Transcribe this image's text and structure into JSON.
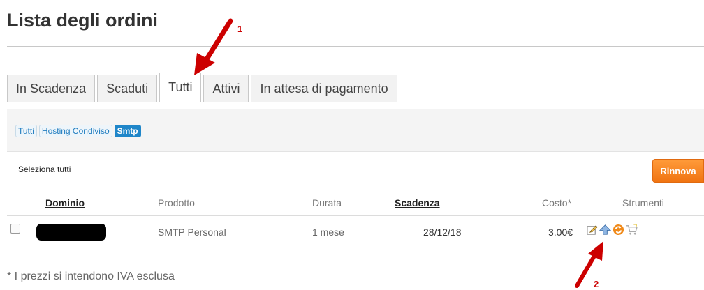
{
  "header": {
    "title": "Lista degli ordini"
  },
  "tabs": [
    {
      "label": "In Scadenza",
      "active": false
    },
    {
      "label": "Scaduti",
      "active": false
    },
    {
      "label": "Tutti",
      "active": true
    },
    {
      "label": "Attivi",
      "active": false
    },
    {
      "label": "In attesa di pagamento",
      "active": false
    }
  ],
  "filters": [
    {
      "label": "Tutti",
      "active": false
    },
    {
      "label": "Hosting Condiviso",
      "active": false
    },
    {
      "label": "Smtp",
      "active": true
    }
  ],
  "toolbar": {
    "select_all": "Seleziona tutti",
    "renew_label": "Rinnova"
  },
  "table": {
    "columns": {
      "domain": "Dominio",
      "product": "Prodotto",
      "duration": "Durata",
      "expiry": "Scadenza",
      "cost": "Costo*",
      "tools": "Strumenti"
    },
    "rows": [
      {
        "product": "SMTP Personal",
        "duration": "1 mese",
        "expiry": "28/12/18",
        "cost": "3.00€",
        "tools": [
          "edit-icon",
          "upgrade-icon",
          "renew-icon",
          "cart-icon"
        ]
      }
    ]
  },
  "footnote": "* I prezzi si intendono IVA esclusa",
  "annotations": {
    "marker_1": "1",
    "marker_2": "2"
  },
  "colors": {
    "accent": "#1f86c9",
    "renew": "#f07412",
    "annotation": "#cc0000"
  }
}
